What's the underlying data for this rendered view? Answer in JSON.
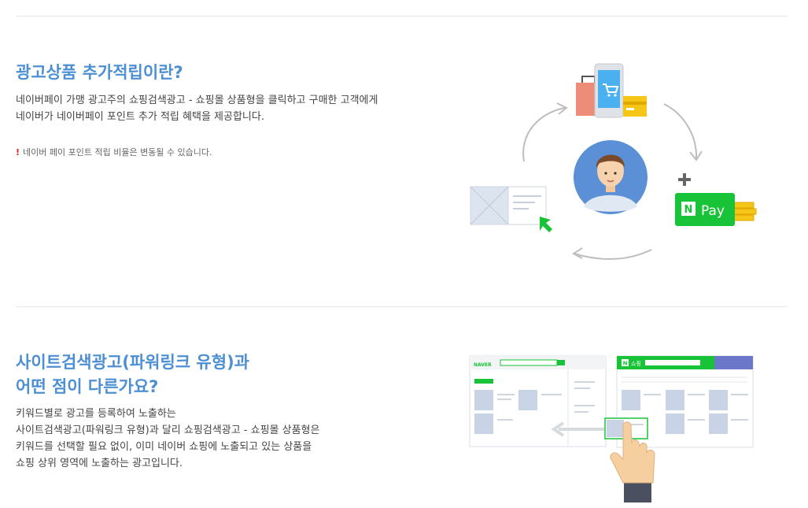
{
  "section1": {
    "title": "광고상품 추가적립이란?",
    "desc_line1": "네이버페이 가맹 광고주의 쇼핑검색광고 - 쇼핑몰 상품형을 클릭하고 구매한 고객에게",
    "desc_line2": "네이버가 네이버페이 포인트 추가 적립 혜택을 제공합니다.",
    "note_mark": "!",
    "note_text": "네이버 페이 포인트 적립 비율은 변동될 수 있습니다.",
    "pay_badge": {
      "n_letter": "N",
      "label": "Pay"
    },
    "plus_sign": "+"
  },
  "section2": {
    "title_line1": "사이트검색광고(파워링크 유형)과",
    "title_line2": "어떤 점이 다른가요?",
    "desc_line1": "키워드별로 광고를 등록하여 노출하는",
    "desc_line2": "사이트검색광고(파워링크 유형)과 달리 쇼핑검색광고 - 쇼핑몰 상품형은",
    "desc_line3": "키워드를 선택할 필요 없이, 이미 네이버 쇼핑에 노출되고 있는 상품을",
    "desc_line4": "쇼핑 상위 영역에 노출하는 광고입니다.",
    "naver_logo": "NAVER",
    "shopping_n": "N",
    "shopping_label": "쇼핑"
  },
  "colors": {
    "accent_blue": "#4d8fd3",
    "naver_green": "#19c337",
    "note_red": "#e02020",
    "coin_yellow": "#f5c518"
  }
}
